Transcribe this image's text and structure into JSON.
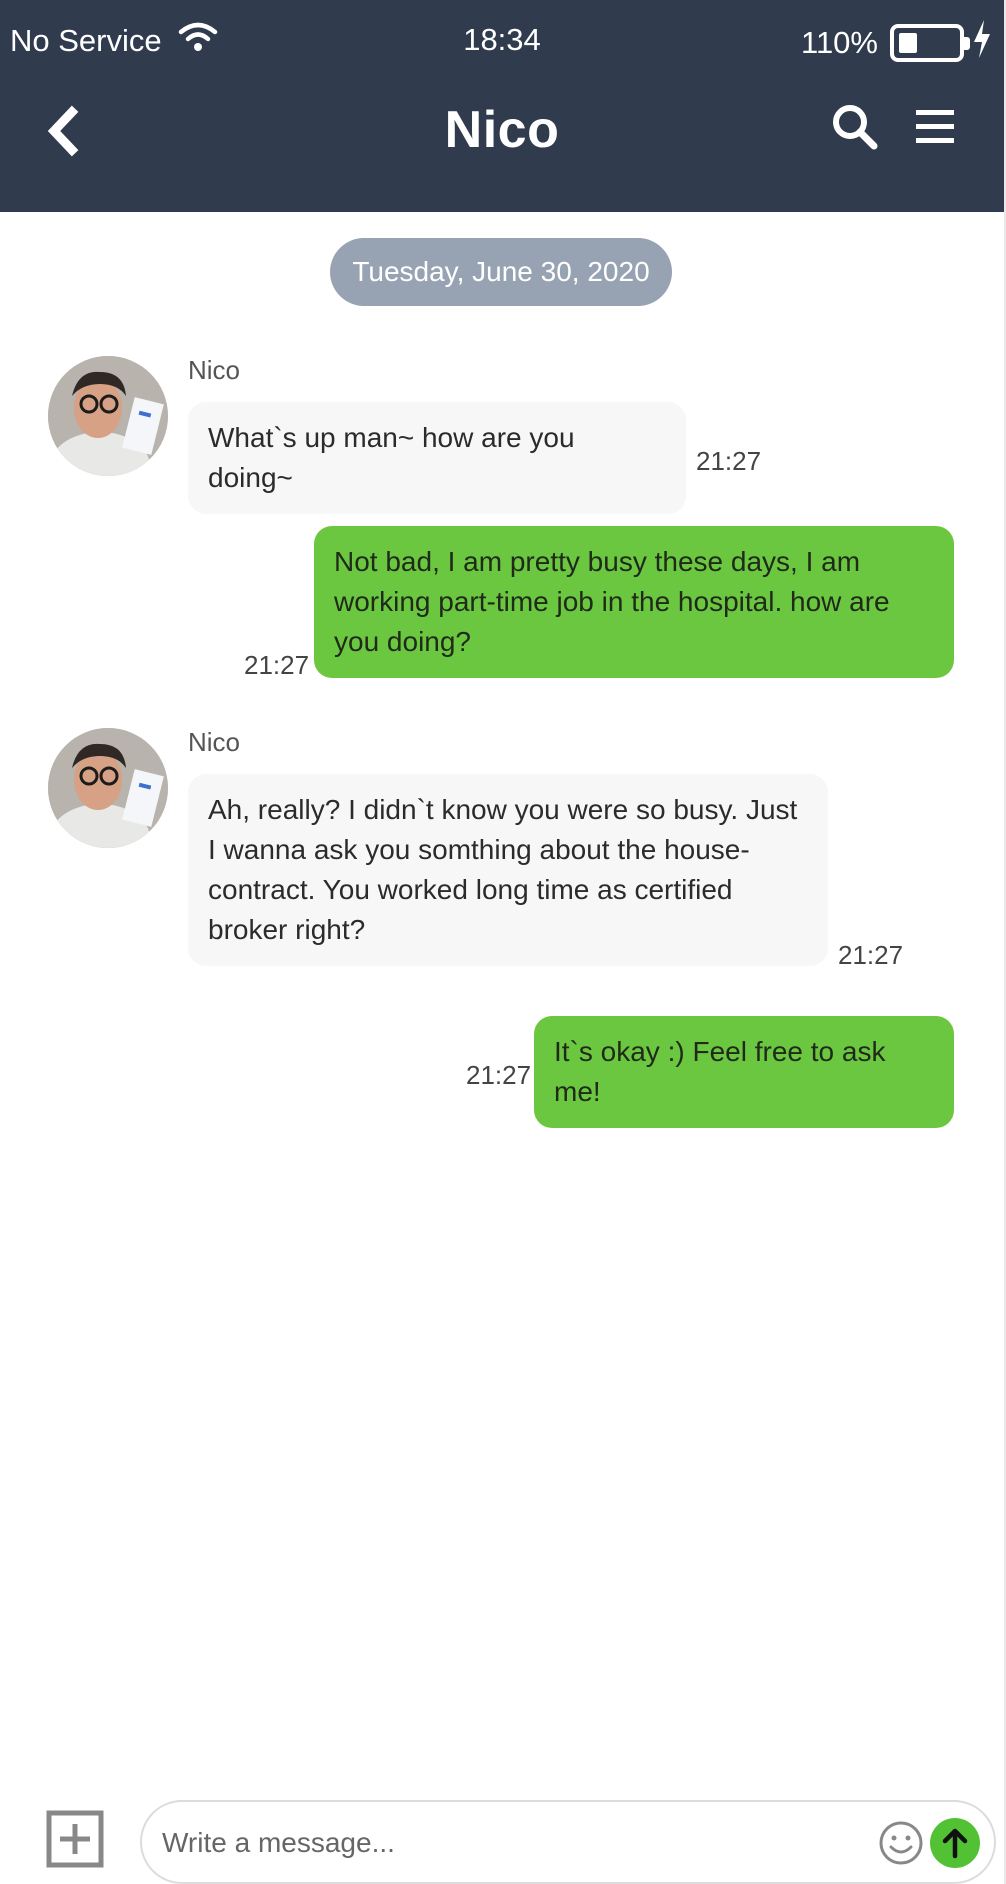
{
  "status_bar": {
    "carrier": "No Service",
    "time": "18:34",
    "battery": "110%"
  },
  "header": {
    "title": "Nico"
  },
  "date_separator": "Tuesday, June 30, 2020",
  "messages": [
    {
      "sender": "Nico",
      "direction": "in",
      "text": "What`s up man~ how are you doing~",
      "time": "21:27"
    },
    {
      "direction": "out",
      "text": "Not bad, I am pretty busy these days, I am working part-time job in the hospital. how are you doing?",
      "time": "21:27"
    },
    {
      "sender": "Nico",
      "direction": "in",
      "text": "Ah, really? I didn`t know you were so busy. Just I wanna ask you somthing about the house-contract. You worked long time as certified broker right?",
      "time": "21:27"
    },
    {
      "direction": "out",
      "text": "It`s okay :) Feel free to ask me!",
      "time": "21:27"
    }
  ],
  "composer": {
    "placeholder": "Write a message..."
  },
  "colors": {
    "header_bg": "#303c4e",
    "outgoing_bubble": "#6bc73f",
    "incoming_bubble": "#f7f7f7",
    "date_pill": "#97a3b3",
    "send_button": "#52c234"
  },
  "icons": [
    "wifi-icon",
    "battery-icon",
    "charging-icon",
    "back-icon",
    "search-icon",
    "menu-icon",
    "add-icon",
    "emoji-icon",
    "send-icon"
  ]
}
